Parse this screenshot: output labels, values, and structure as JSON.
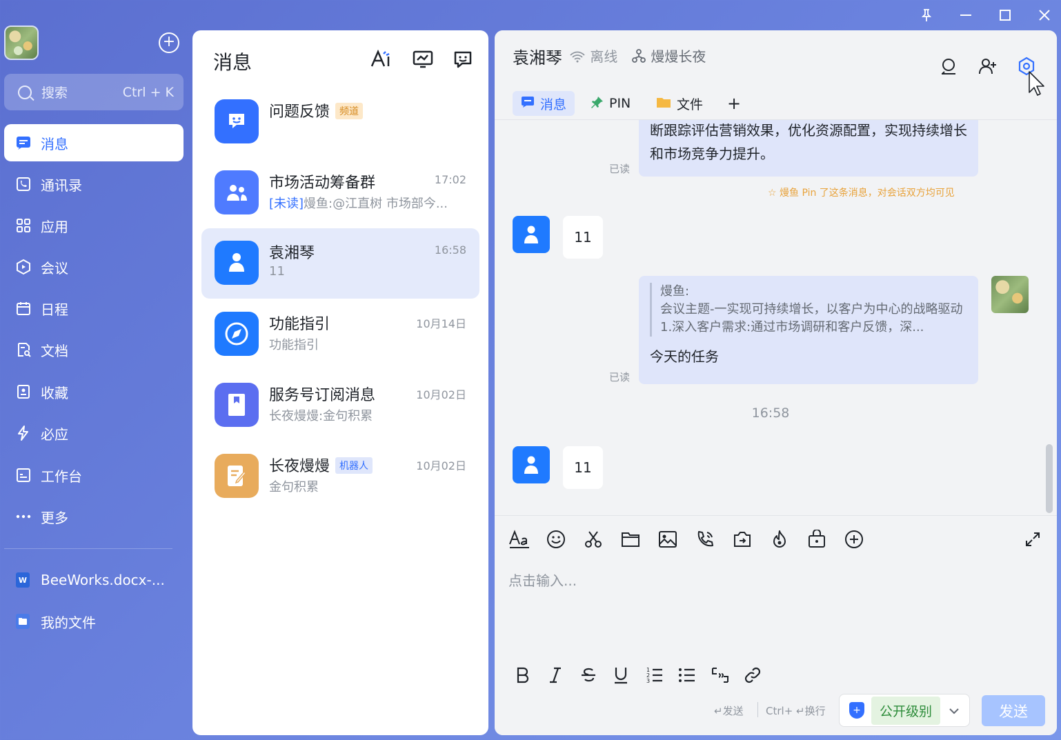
{
  "window_controls": {
    "pin": "⊥",
    "minimize": "—",
    "maximize": "☐",
    "close": "✕"
  },
  "sidebar": {
    "add_button": "+",
    "search": {
      "placeholder": "搜索",
      "shortcut": "Ctrl + K"
    },
    "nav": [
      {
        "label": "消息",
        "icon": "message-icon",
        "glyph": "▤",
        "active": true
      },
      {
        "label": "通讯录",
        "icon": "contacts-icon",
        "glyph": "☏"
      },
      {
        "label": "应用",
        "icon": "apps-icon",
        "glyph": "▦"
      },
      {
        "label": "会议",
        "icon": "meeting-icon",
        "glyph": "▷"
      },
      {
        "label": "日程",
        "icon": "calendar-icon",
        "glyph": "▭"
      },
      {
        "label": "文档",
        "icon": "docs-icon",
        "glyph": "✎"
      },
      {
        "label": "收藏",
        "icon": "favorites-icon",
        "glyph": "⊡"
      },
      {
        "label": "必应",
        "icon": "lightning-icon",
        "glyph": "ϟ"
      },
      {
        "label": "工作台",
        "icon": "workbench-icon",
        "glyph": "▣"
      },
      {
        "label": "更多",
        "icon": "more-icon",
        "glyph": "···"
      }
    ],
    "files": [
      {
        "label": "BeeWorks.docx-...",
        "icon": "word-file-icon",
        "glyph": "W",
        "color": "#2b66d9"
      },
      {
        "label": "我的文件",
        "icon": "my-files-icon",
        "glyph": "▬",
        "color": "#4a7be8"
      }
    ]
  },
  "conversations_panel": {
    "title": "消息",
    "actions": [
      "ai-icon",
      "chart-icon",
      "chat-face-icon"
    ],
    "items": [
      {
        "name": "问题反馈",
        "tag": "频道",
        "tag_style": "orange",
        "time": "",
        "preview": "",
        "unread_prefix": "",
        "avatar_color": "#3370ff",
        "glyph": "☺"
      },
      {
        "name": "市场活动筹备群",
        "tag": "",
        "time": "17:02",
        "unread_prefix": "[未读]",
        "preview": "熳鱼:@江直树 市场部今...",
        "avatar_color": "#4f7bff",
        "glyph": "⚇"
      },
      {
        "name": "袁湘琴",
        "tag": "",
        "time": "16:58",
        "unread_prefix": "",
        "preview": "11",
        "avatar_color": "#1f7aff",
        "glyph": "●",
        "selected": true
      },
      {
        "name": "功能指引",
        "tag": "",
        "time": "10月14日",
        "unread_prefix": "",
        "preview": "功能指引",
        "avatar_color": "#1f7aff",
        "glyph": "◈"
      },
      {
        "name": "服务号订阅消息",
        "tag": "",
        "time": "10月02日",
        "unread_prefix": "",
        "preview": "长夜熳熳:金句积累",
        "avatar_color": "#5b6ef0",
        "glyph": "▮"
      },
      {
        "name": "长夜熳熳",
        "tag": "机器人",
        "tag_style": "blue",
        "time": "10月02日",
        "unread_prefix": "",
        "preview": "金句积累",
        "avatar_color": "#e8ab5c",
        "glyph": "✎"
      }
    ]
  },
  "chat": {
    "name": "袁湘琴",
    "status": "离线",
    "team": "熳熳长夜",
    "tabs": [
      {
        "label": "消息",
        "active": true
      },
      {
        "label": "PIN"
      },
      {
        "label": "文件"
      },
      {
        "label": "+"
      }
    ],
    "messages": {
      "m1_text": "断跟踪评估营销效果，优化资源配置，实现持续增长和市场竞争力提升。",
      "m1_read": "已读",
      "pin_note": "☆ 熳鱼 Pin 了这条消息，对会话双方均可见",
      "m2_text": "11",
      "m3_quote_author": "熳鱼:",
      "m3_quote_text": "会议主题-一实现可持续增长，以客户为中心的战略驱动 1.深入客户需求:通过市场调研和客户反馈，深...",
      "m3_text": "今天的任务",
      "m3_read": "已读",
      "time_divider": "16:58",
      "m4_text": "11"
    },
    "editor": {
      "placeholder": "点击输入...",
      "hint_send": "↵发送",
      "hint_newline": "Ctrl+ ↵换行",
      "security_level": "公开级别",
      "send_label": "发送"
    }
  }
}
